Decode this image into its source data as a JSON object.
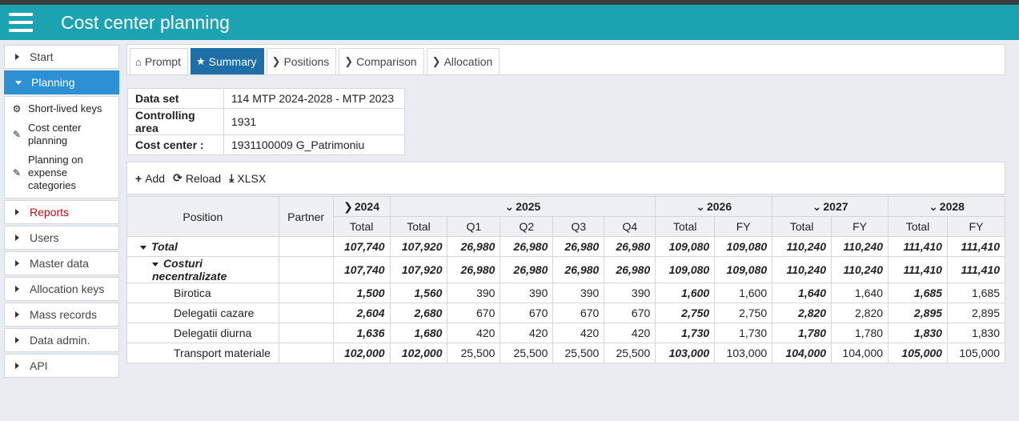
{
  "app": {
    "title": "Cost center planning"
  },
  "sidebar": {
    "items": [
      {
        "label": "Start"
      },
      {
        "label": "Planning"
      },
      {
        "label": "Reports"
      },
      {
        "label": "Users"
      },
      {
        "label": "Master data"
      },
      {
        "label": "Allocation keys"
      },
      {
        "label": "Mass records"
      },
      {
        "label": "Data admin."
      },
      {
        "label": "API"
      }
    ],
    "planning_sub": [
      {
        "label": "Short-lived keys",
        "icon": "gear-icon"
      },
      {
        "label": "Cost center planning",
        "icon": "pencil-icon"
      },
      {
        "label": "Planning on expense categories",
        "icon": "pencil-icon"
      }
    ]
  },
  "tabs": [
    {
      "label": "Prompt",
      "icon": "home-icon"
    },
    {
      "label": "Summary",
      "icon": "star-icon"
    },
    {
      "label": "Positions",
      "icon": "chevron-right-icon"
    },
    {
      "label": "Comparison",
      "icon": "chevron-right-icon"
    },
    {
      "label": "Allocation",
      "icon": "chevron-right-icon"
    }
  ],
  "info": [
    {
      "key": "Data set",
      "value": "114 MTP 2024-2028 - MTP 2023"
    },
    {
      "key": "Controlling area",
      "value": "1931"
    },
    {
      "key": "Cost center :",
      "value": "1931100009 G_Patrimoniu"
    }
  ],
  "toolbar": {
    "add": "Add",
    "reload": "Reload",
    "xlsx": "XLSX"
  },
  "grid": {
    "position_header": "Position",
    "partner_header": "Partner",
    "years": [
      "2024",
      "2025",
      "2026",
      "2027",
      "2028"
    ],
    "subheaders": [
      "Total",
      "Total",
      "Q1",
      "Q2",
      "Q3",
      "Q4",
      "Total",
      "FY",
      "Total",
      "FY",
      "Total",
      "FY"
    ],
    "rows": [
      {
        "position": "Total",
        "partner": "",
        "values": [
          "107,740",
          "107,920",
          "26,980",
          "26,980",
          "26,980",
          "26,980",
          "109,080",
          "109,080",
          "110,240",
          "110,240",
          "111,410",
          "111,410"
        ]
      },
      {
        "position": "Costuri necentralizate",
        "partner": "",
        "values": [
          "107,740",
          "107,920",
          "26,980",
          "26,980",
          "26,980",
          "26,980",
          "109,080",
          "109,080",
          "110,240",
          "110,240",
          "111,410",
          "111,410"
        ]
      },
      {
        "position": "Birotica",
        "partner": "",
        "values": [
          "1,500",
          "1,560",
          "390",
          "390",
          "390",
          "390",
          "1,600",
          "1,600",
          "1,640",
          "1,640",
          "1,685",
          "1,685"
        ]
      },
      {
        "position": "Delegatii cazare",
        "partner": "",
        "values": [
          "2,604",
          "2,680",
          "670",
          "670",
          "670",
          "670",
          "2,750",
          "2,750",
          "2,820",
          "2,820",
          "2,895",
          "2,895"
        ]
      },
      {
        "position": "Delegatii diurna",
        "partner": "",
        "values": [
          "1,636",
          "1,680",
          "420",
          "420",
          "420",
          "420",
          "1,730",
          "1,730",
          "1,780",
          "1,780",
          "1,830",
          "1,830"
        ]
      },
      {
        "position": "Transport materiale",
        "partner": "",
        "values": [
          "102,000",
          "102,000",
          "25,500",
          "25,500",
          "25,500",
          "25,500",
          "103,000",
          "103,000",
          "104,000",
          "104,000",
          "105,000",
          "105,000"
        ]
      }
    ]
  }
}
